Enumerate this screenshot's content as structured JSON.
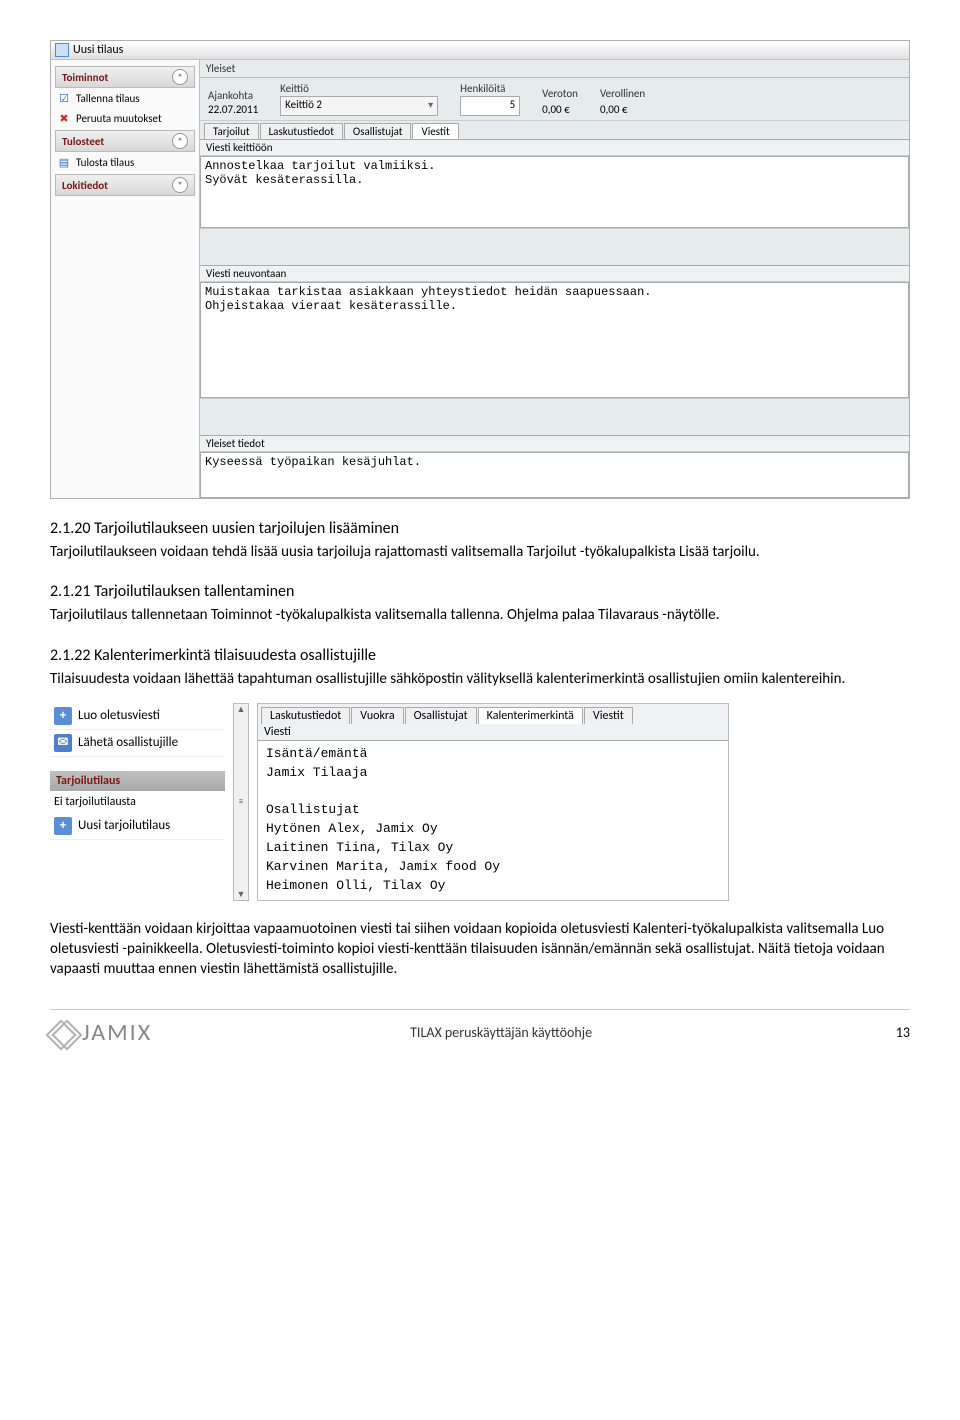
{
  "app1": {
    "title": "Uusi tilaus",
    "sidebar": {
      "sections": [
        {
          "title": "Toiminnot",
          "items": [
            {
              "icon": "☑",
              "iconClass": "blue",
              "label": "Tallenna tilaus",
              "name": "save-order"
            },
            {
              "icon": "✖",
              "iconClass": "red",
              "label": "Peruuta muutokset",
              "name": "cancel-changes"
            }
          ]
        },
        {
          "title": "Tulosteet",
          "items": [
            {
              "icon": "📄",
              "iconClass": "blue",
              "label": "Tulosta tilaus",
              "name": "print-order"
            }
          ]
        },
        {
          "title": "Lokitiedot",
          "items": []
        }
      ]
    },
    "fieldsetLabel": "Yleiset",
    "fields": {
      "ajankohta_label": "Ajankohta",
      "ajankohta": "22.07.2011",
      "keittio_label": "Keittiö",
      "keittio": "Keittiö 2",
      "henkiloita_label": "Henkilöitä",
      "henkiloita": "5",
      "veroton_label": "Veroton",
      "veroton": "0,00 €",
      "verollinen_label": "Verollinen",
      "verollinen": "0,00 €"
    },
    "tabs": [
      "Tarjoilut",
      "Laskutustiedot",
      "Osallistujat",
      "Viestit"
    ],
    "activeTab": 3,
    "msg1_label": "Viesti keittiöön",
    "msg1": "Annostelkaa tarjoilut valmiiksi.\nSyövät kesäterassilla.",
    "msg2_label": "Viesti neuvontaan",
    "msg2": "Muistakaa tarkistaa asiakkaan yhteystiedot heidän saapuessaan.\nOhjeistakaa vieraat kesäterassille.",
    "msg3_label": "Yleiset tiedot",
    "msg3": "Kyseessä työpaikan kesäjuhlat."
  },
  "doc": {
    "h1": "2.1.20 Tarjoilutilaukseen uusien tarjoilujen lisääminen",
    "p1": "Tarjoilutilaukseen voidaan tehdä lisää uusia tarjoiluja rajattomasti valitsemalla Tarjoilut -työkalupalkista Lisää tarjoilu.",
    "h2": "2.1.21 Tarjoilutilauksen tallentaminen",
    "p2": "Tarjoilutilaus tallennetaan Toiminnot -työkalupalkista valitsemalla tallenna. Ohjelma palaa Tilavaraus -näytölle.",
    "h3": "2.1.22 Kalenterimerkintä tilaisuudesta osallistujille",
    "p3": "Tilaisuudesta voidaan lähettää tapahtuman osallistujille sähköpostin välityksellä kalenterimerkintä osallistujien omiin kalentereihin.",
    "p4": "Viesti-kenttään voidaan kirjoittaa vapaamuotoinen viesti tai siihen voidaan kopioida oletusviesti Kalenteri-työkalupalkista valitsemalla Luo oletusviesti -painikkeella.  Oletusviesti-toiminto kopioi viesti-kenttään tilaisuuden isännän/emännän sekä osallistujat. Näitä tietoja voidaan vapaasti muuttaa ennen viestin lähettämistä osallistujille."
  },
  "fig2": {
    "left": {
      "create_default": "Luo oletusviesti",
      "send": "Lähetä osallistujille",
      "section": "Tarjoilutilaus",
      "no_order": "Ei tarjoilutilausta",
      "new_order": "Uusi tarjoilutilaus"
    },
    "tabs": [
      "Laskutustiedot",
      "Vuokra",
      "Osallistujat",
      "Kalenterimerkintä",
      "Viestit"
    ],
    "activeTab": 3,
    "viesti_label": "Viesti",
    "body": "Isäntä/emäntä\nJamix Tilaaja\n\nOsallistujat\nHytönen Alex, Jamix Oy\nLaitinen Tiina, Tilax Oy\nKarvinen Marita, Jamix food Oy\nHeimonen Olli, Tilax Oy"
  },
  "footer": {
    "brand": "JAMIX",
    "center": "TILAX peruskäyttäjän käyttöohje",
    "page": "13"
  }
}
